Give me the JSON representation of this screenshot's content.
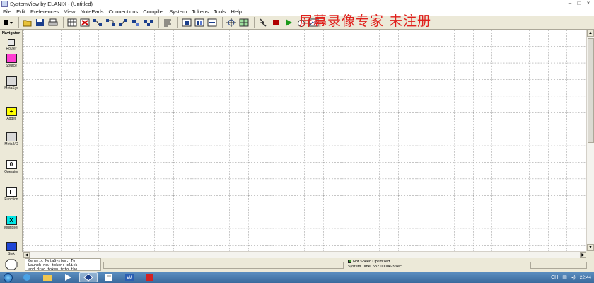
{
  "window": {
    "title": "SystemView by ELANIX - (Untitled)",
    "controls": [
      "–",
      "□",
      "×"
    ]
  },
  "menubar": [
    "File",
    "Edit",
    "Preferences",
    "View",
    "NotePads",
    "Connections",
    "Compiler",
    "System",
    "Tokens",
    "Tools",
    "Help"
  ],
  "watermark": "屏幕录像专家  未注册",
  "navigator": {
    "heading": "Navigator",
    "tokens": [
      {
        "label": "Router",
        "glyph": "",
        "color": "#e8e8e8"
      },
      {
        "label": "Source",
        "glyph": "",
        "color": "#ff3fd2"
      },
      {
        "label": "MetaSys",
        "glyph": "",
        "color": "#d8d8d8"
      },
      {
        "label": "Adder",
        "glyph": "+",
        "color": "#ffff00"
      },
      {
        "label": "Meta I/O",
        "glyph": "",
        "color": "#d8d8d8"
      },
      {
        "label": "Operator",
        "glyph": "0",
        "color": "#ffffff"
      },
      {
        "label": "Function",
        "glyph": "F",
        "color": "#ffffff"
      },
      {
        "label": "Multiplier",
        "glyph": "X",
        "color": "#00e6e6"
      },
      {
        "label": "Sink",
        "glyph": "",
        "color": "#1f46d6"
      }
    ]
  },
  "status": {
    "message": "Generic MetaSystem. To\nLaunch new token: click\nand drag token into the",
    "speed": "Not Speed Optimized",
    "system_time": "System Time: 582.0000e-3 sec",
    "stop_label": "Stop"
  },
  "taskbar": {
    "clock": "22:44"
  },
  "colors": {
    "watermark": "#e0201d",
    "taskbar": "#3a6a9d"
  }
}
